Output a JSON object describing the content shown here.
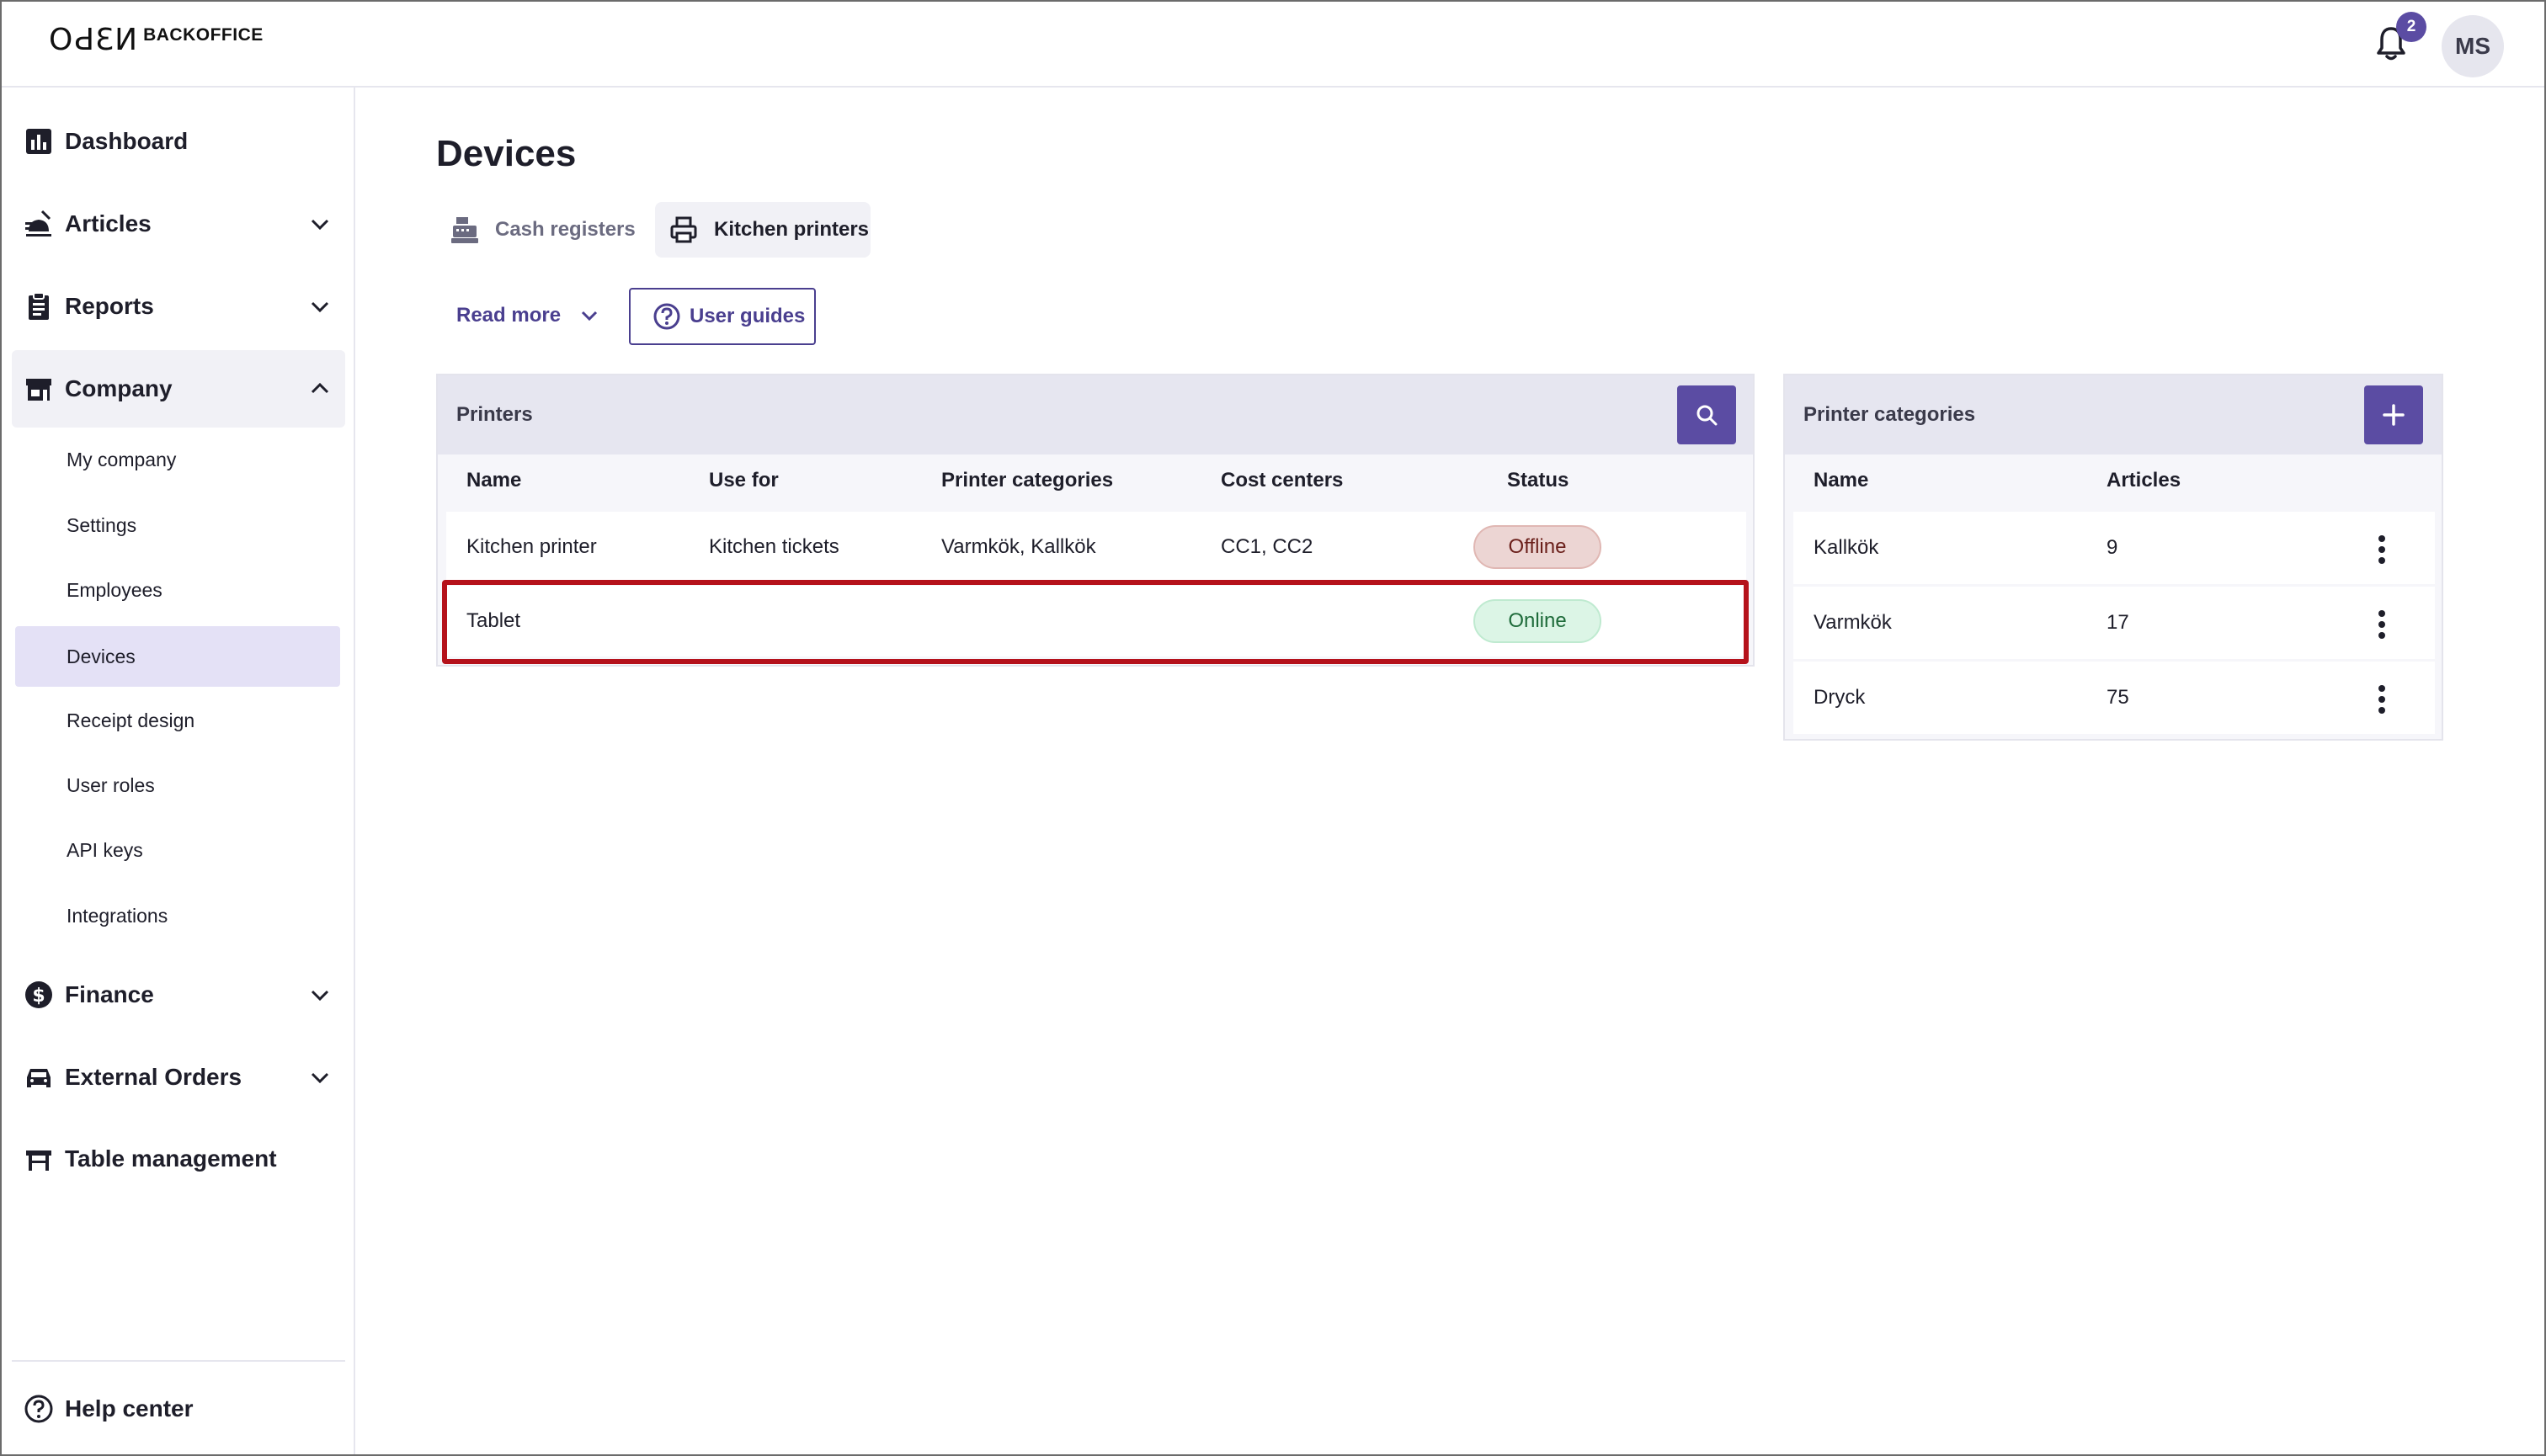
{
  "header": {
    "logo_mark": "OԀƐИ",
    "logo_text": "BACKOFFICE",
    "notification_count": "2",
    "avatar_initials": "MS"
  },
  "sidebar": {
    "items": [
      {
        "label": "Dashboard",
        "icon": "dashboard-icon"
      },
      {
        "label": "Articles",
        "icon": "articles-icon",
        "expandable": true
      },
      {
        "label": "Reports",
        "icon": "reports-icon",
        "expandable": true
      },
      {
        "label": "Company",
        "icon": "company-icon",
        "expandable": true,
        "expanded": true
      },
      {
        "label": "Finance",
        "icon": "finance-icon",
        "expandable": true
      },
      {
        "label": "External Orders",
        "icon": "external-orders-icon",
        "expandable": true
      },
      {
        "label": "Table management",
        "icon": "table-management-icon"
      }
    ],
    "company_sub": [
      "My company",
      "Settings",
      "Employees",
      "Devices",
      "Receipt design",
      "User roles",
      "API keys",
      "Integrations"
    ],
    "active_sub": "Devices",
    "help_label": "Help center"
  },
  "main": {
    "title": "Devices",
    "tabs": [
      {
        "label": "Cash registers",
        "icon": "cash-register-icon"
      },
      {
        "label": "Kitchen printers",
        "icon": "printer-icon",
        "selected": true
      }
    ],
    "read_more": "Read more",
    "user_guides": "User guides"
  },
  "printers": {
    "title": "Printers",
    "columns": [
      "Name",
      "Use for",
      "Printer categories",
      "Cost centers",
      "Status"
    ],
    "rows": [
      {
        "name": "Kitchen printer",
        "use_for": "Kitchen tickets",
        "categories": "Varmkök, Kallkök",
        "cost_centers": "CC1, CC2",
        "status": "Offline"
      },
      {
        "name": "Tablet",
        "use_for": "",
        "categories": "",
        "cost_centers": "",
        "status": "Online"
      }
    ]
  },
  "printer_categories": {
    "title": "Printer categories",
    "columns": [
      "Name",
      "Articles"
    ],
    "rows": [
      {
        "name": "Kallkök",
        "articles": "9"
      },
      {
        "name": "Varmkök",
        "articles": "17"
      },
      {
        "name": "Dryck",
        "articles": "75"
      }
    ]
  },
  "colors": {
    "accent": "#5b4ca3",
    "highlight": "#b5121b",
    "offline_bg": "#ecd5d3",
    "online_bg": "#dcf5e6"
  }
}
